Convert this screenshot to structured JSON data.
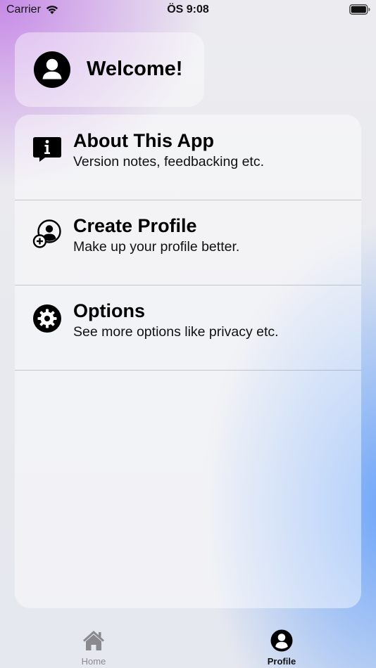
{
  "status_bar": {
    "carrier": "Carrier",
    "time": "ÖS 9:08"
  },
  "welcome": {
    "text": "Welcome!",
    "icon": "person-circle-icon"
  },
  "menu": {
    "items": [
      {
        "title": "About This App",
        "subtitle": "Version notes, feedbacking etc.",
        "icon": "info-bubble-icon"
      },
      {
        "title": "Create Profile",
        "subtitle": "Make up your profile better.",
        "icon": "person-add-icon"
      },
      {
        "title": "Options",
        "subtitle": "See more options like privacy etc.",
        "icon": "gear-icon"
      }
    ]
  },
  "tab_bar": {
    "tabs": [
      {
        "label": "Home",
        "icon": "house-icon",
        "selected": false
      },
      {
        "label": "Profile",
        "icon": "person-circle-icon",
        "selected": true
      }
    ]
  },
  "colors": {
    "active_tab": "#111111",
    "inactive_tab": "#8a8a8e",
    "accent_purple": "#c484e6",
    "accent_blue": "#64a0fa"
  }
}
